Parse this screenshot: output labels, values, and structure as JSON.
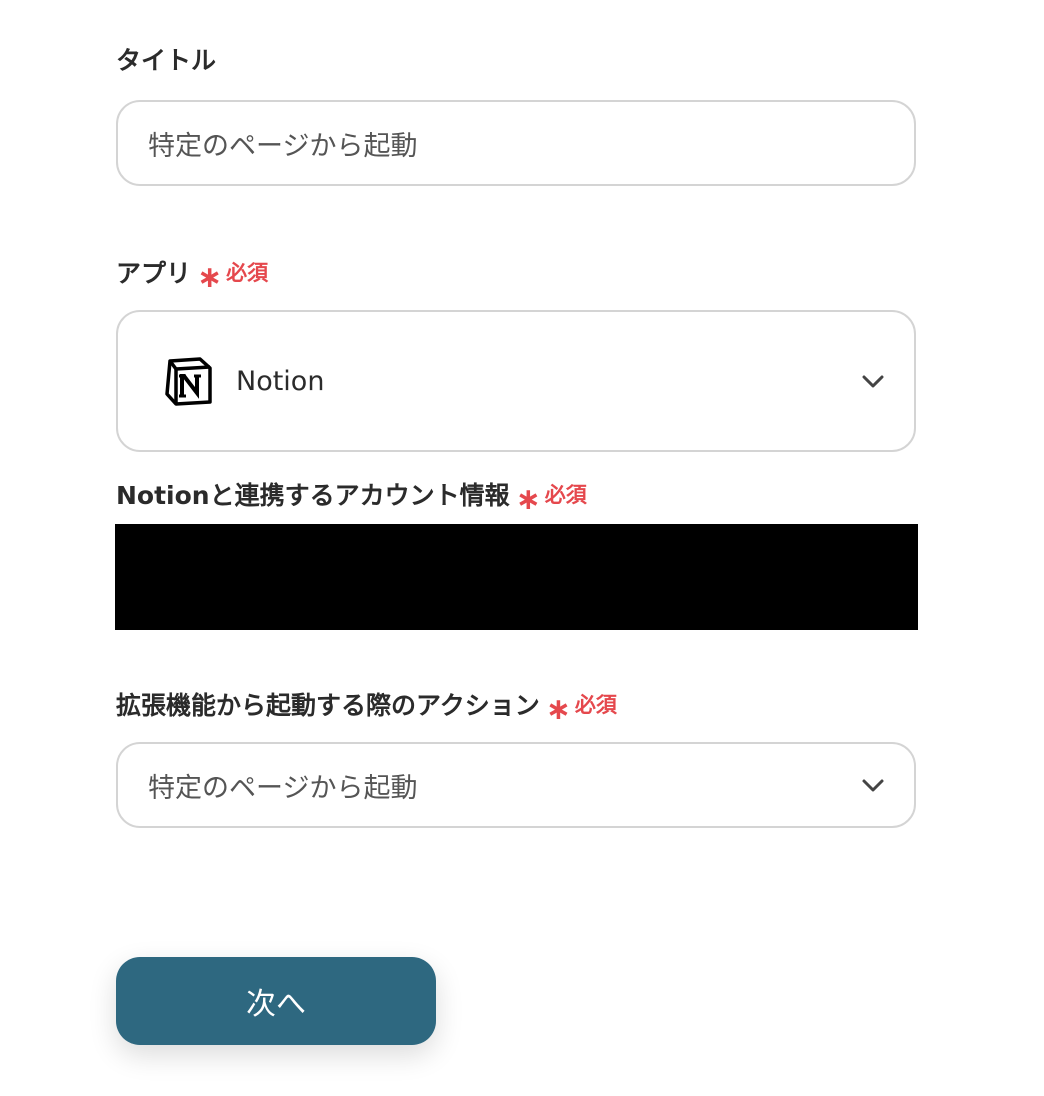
{
  "form": {
    "title_section": {
      "label": "タイトル",
      "value": "特定のページから起動"
    },
    "app_section": {
      "label": "アプリ",
      "required_star": "∗",
      "required_text": "必須",
      "selected_app": "Notion",
      "icon": "notion-logo-icon"
    },
    "account_section": {
      "label": "Notionと連携するアカウント情報",
      "required_star": "∗",
      "required_text": "必須"
    },
    "action_section": {
      "label": "拡張機能から起動する際のアクション",
      "required_star": "∗",
      "required_text": "必須",
      "selected_value": "特定のページから起動"
    }
  },
  "buttons": {
    "next_label": "次へ"
  },
  "colors": {
    "required": "#e5484d",
    "primary_button": "#2e6880",
    "border": "#d4d4d4"
  }
}
